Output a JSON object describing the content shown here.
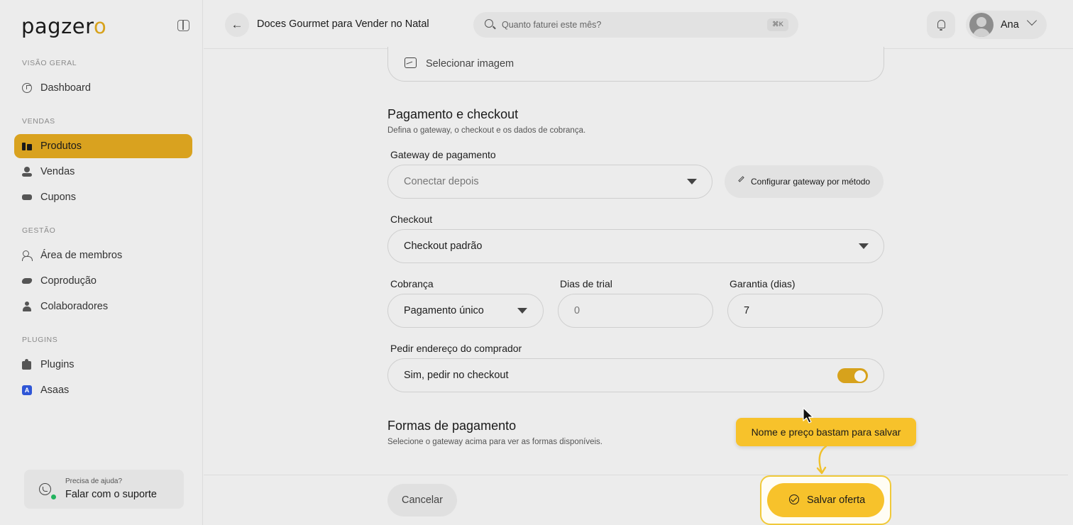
{
  "app": {
    "logo_main": "pagzer",
    "logo_accent": "o"
  },
  "sidebar": {
    "sections": [
      {
        "label": "VISÃO GERAL"
      },
      {
        "label": "VENDAS"
      },
      {
        "label": "GESTÃO"
      },
      {
        "label": "PLUGINS"
      }
    ],
    "items": [
      {
        "label": "Dashboard",
        "icon": "dashboard-icon"
      },
      {
        "label": "Produtos",
        "icon": "products-icon",
        "active": true
      },
      {
        "label": "Vendas",
        "icon": "sales-icon"
      },
      {
        "label": "Cupons",
        "icon": "coupon-icon"
      },
      {
        "label": "Área de membros",
        "icon": "members-icon"
      },
      {
        "label": "Coprodução",
        "icon": "handshake-icon"
      },
      {
        "label": "Colaboradores",
        "icon": "collaborators-icon"
      },
      {
        "label": "Plugins",
        "icon": "puzzle-icon"
      },
      {
        "label": "Asaas",
        "icon": "asaas-logo-icon",
        "icon_letter": "A"
      }
    ],
    "support": {
      "small": "Precisa de ajuda?",
      "big": "Falar com o suporte",
      "icon": "whatsapp-icon"
    }
  },
  "topbar": {
    "title": "Doces Gourmet para Vender no Natal",
    "search_placeholder": "Quanto faturei este mês?",
    "search_shortcut": "⌘K",
    "user_name": "Ana"
  },
  "form": {
    "image_picker_label": "Selecionar imagem",
    "payment_section": {
      "title": "Pagamento e checkout",
      "description": "Defina o gateway, o checkout e os dados de cobrança."
    },
    "gateway": {
      "label": "Gateway de pagamento",
      "value": "Conectar depois",
      "configure_button": "Configurar gateway por método"
    },
    "checkout": {
      "label": "Checkout",
      "value": "Checkout padrão"
    },
    "billing": {
      "label": "Cobrança",
      "value": "Pagamento único"
    },
    "trial_days": {
      "label": "Dias de trial",
      "placeholder": "0"
    },
    "guarantee_days": {
      "label": "Garantia (dias)",
      "value": "7"
    },
    "ask_address": {
      "label": "Pedir endereço do comprador",
      "value": "Sim, pedir no checkout",
      "enabled": true
    },
    "payment_methods": {
      "title": "Formas de pagamento",
      "description": "Selecione o gateway acima para ver as formas disponíveis."
    }
  },
  "footer": {
    "cancel_label": "Cancelar",
    "save_label": "Salvar oferta"
  },
  "tooltip": {
    "text": "Nome e preço bastam para salvar"
  },
  "colors": {
    "accent": "#d9a21f",
    "save": "#f7c22b",
    "background": "#ececec"
  }
}
